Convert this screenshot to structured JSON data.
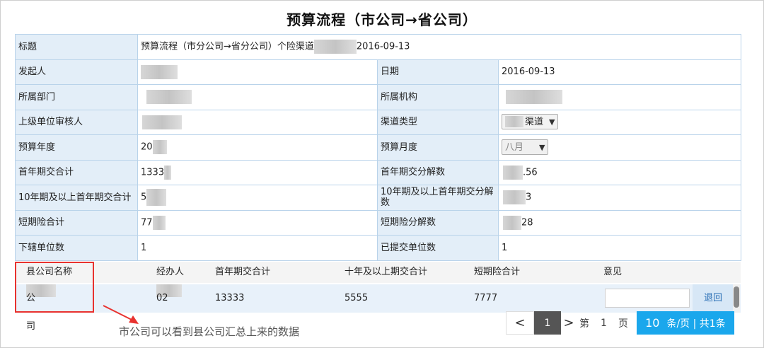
{
  "title": "预算流程（市公司→省公司）",
  "form": {
    "title_label": "标题",
    "title_value_prefix": "预算流程（市分公司→省分公司）个险渠道",
    "title_value_date": "2016-09-13",
    "initiator_label": "发起人",
    "date_label": "日期",
    "date_value": "2016-09-13",
    "dept_label": "所属部门",
    "org_label": "所属机构",
    "reviewer_label": "上级单位审核人",
    "channel_type_label": "渠道类型",
    "channel_type_value": "渠道",
    "budget_year_label": "预算年度",
    "budget_year_value": "20",
    "budget_month_label": "预算月度",
    "budget_month_value": "八月",
    "first_year_total_label": "首年期交合计",
    "first_year_total_value": "1333",
    "first_year_split_label": "首年期交分解数",
    "first_year_split_value": ".56",
    "ten_year_total_label": "10年期及以上首年期交合计",
    "ten_year_total_value": "5",
    "ten_year_split_label": "10年期及以上首年期交分解数",
    "ten_year_split_value": "3",
    "short_total_label": "短期险合计",
    "short_total_value": "77",
    "short_split_label": "短期险分解数",
    "short_split_value": "28",
    "sub_units_label": "下辖单位数",
    "sub_units_value": "1",
    "submitted_label": "已提交单位数",
    "submitted_value": "1"
  },
  "sub_table": {
    "headers": [
      "县公司名称",
      "经办人",
      "首年期交合计",
      "十年及以上期交合计",
      "短期险合计",
      "意见"
    ],
    "row": {
      "company": "公司",
      "handler": "02",
      "first_year": "13333",
      "ten_year": "5555",
      "short": "7777",
      "return_label": "退回"
    }
  },
  "annotation": "市公司可以看到县公司汇总上来的数据",
  "pager": {
    "prev": "<",
    "current": "1",
    "next": ">",
    "page_prefix": "第",
    "page_num": "1",
    "page_suffix": "页",
    "page_size": "10",
    "size_text": "条/页 | 共1条"
  },
  "colors": {
    "label_bg": "#e3eef8",
    "border": "#b9d3ea",
    "accent": "#1aa7ec",
    "highlight": "#e8322f"
  }
}
